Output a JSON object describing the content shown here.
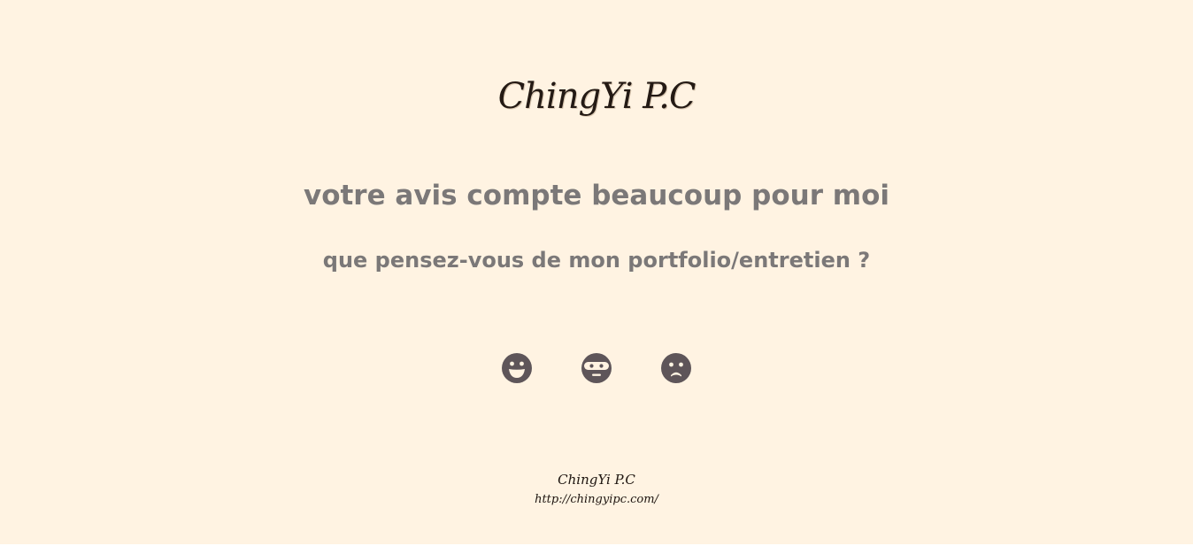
{
  "header": {
    "logo_text": "ChingYi P.C"
  },
  "main": {
    "headline": "votre avis compte beaucoup pour moi",
    "question": "que pensez-vous de mon portfolio/entretien ?",
    "ratings": [
      {
        "icon": "happy-face-icon",
        "sentiment": "positive"
      },
      {
        "icon": "neutral-face-icon",
        "sentiment": "neutral"
      },
      {
        "icon": "sad-face-icon",
        "sentiment": "negative"
      }
    ]
  },
  "footer": {
    "name": "ChingYi P.C",
    "url": "http://chingyipc.com/"
  },
  "colors": {
    "background": "#fff3e2",
    "text_gray": "#7b7878",
    "icon": "#5e5559",
    "logo": "#241a14"
  }
}
